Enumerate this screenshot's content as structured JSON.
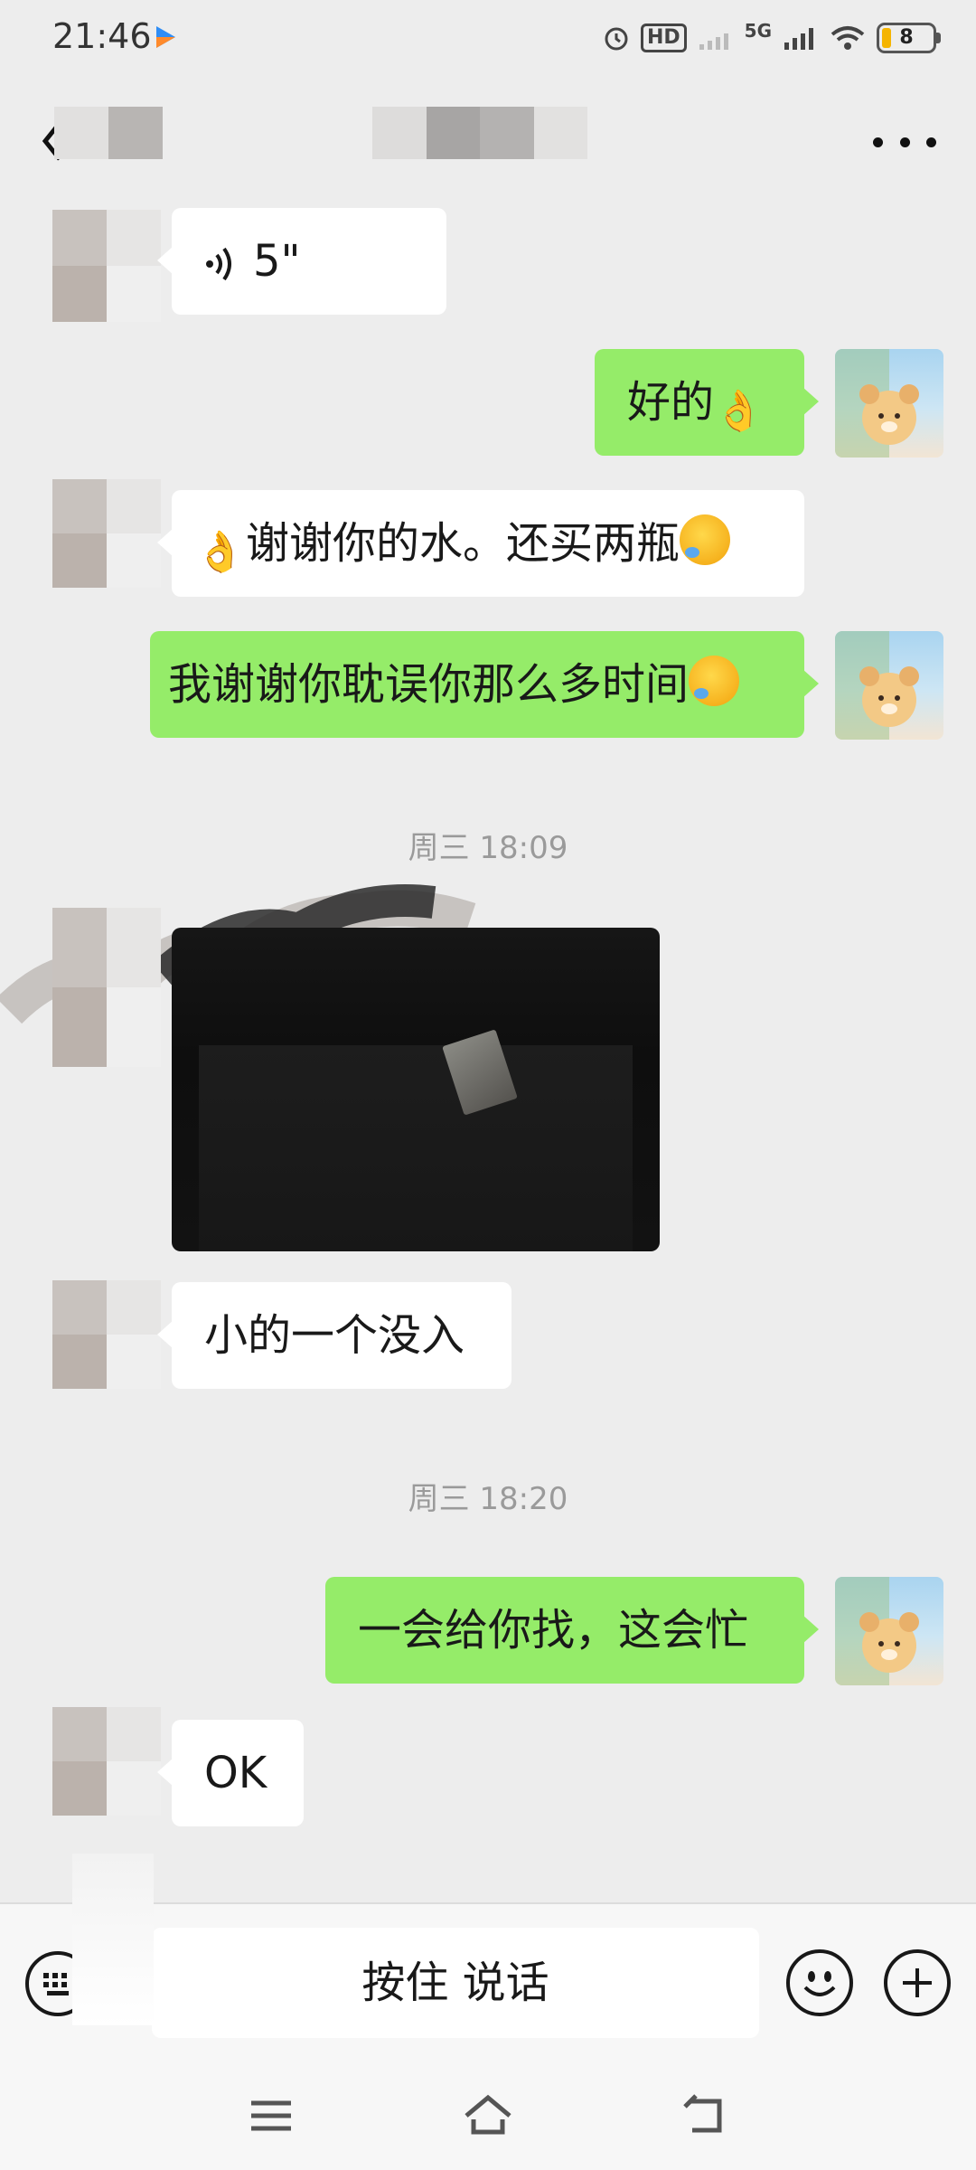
{
  "status_bar": {
    "time": "21:46",
    "hd_label": "HD",
    "network": "5G",
    "battery": "8"
  },
  "header": {
    "back_icon": "chevron-left-icon",
    "more_icon": "more-dots-icon"
  },
  "messages": [
    {
      "side": "in",
      "type": "voice",
      "text": "5\""
    },
    {
      "side": "out",
      "type": "text",
      "text": "好的",
      "emoji": "ok-hand"
    },
    {
      "side": "in",
      "type": "text",
      "text": "谢谢你的水。还买两瓶",
      "emoji": "laughing-tears"
    },
    {
      "side": "out",
      "type": "text",
      "text": "我谢谢你耽误你那么多时间",
      "emoji": "laughing-tears"
    },
    {
      "side": "in",
      "type": "image"
    },
    {
      "side": "in",
      "type": "text",
      "text": "小的一个没入"
    },
    {
      "side": "out",
      "type": "text",
      "text": "一会给你找，这会忙"
    },
    {
      "side": "in",
      "type": "text",
      "text": "OK"
    }
  ],
  "timestamps": [
    "周三 18:09",
    "周三 18:20"
  ],
  "input_bar": {
    "hold_to_talk": "按住 说话",
    "keyboard_icon": "keyboard-icon",
    "emoji_icon": "emoji-icon",
    "plus_icon": "plus-icon"
  },
  "colors": {
    "background": "#ededed",
    "outgoing_bubble": "#95ec69",
    "incoming_bubble": "#ffffff"
  }
}
